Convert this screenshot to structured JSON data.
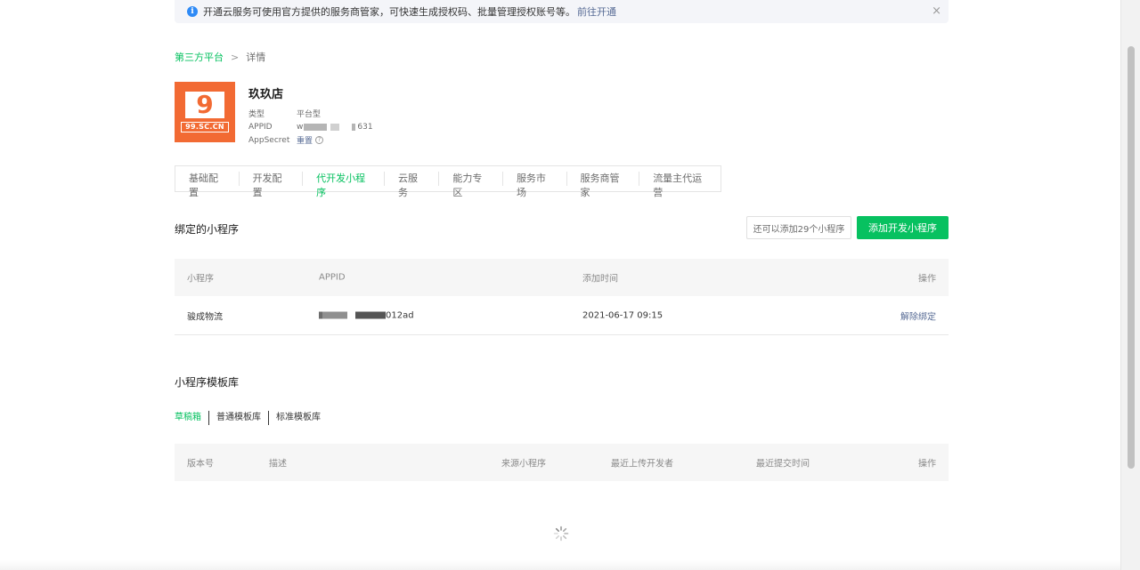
{
  "notice": {
    "icon": "info-icon",
    "text": "开通云服务可使用官方提供的服务商管家，可快速生成授权码、批量管理授权账号等。",
    "link": "前往开通",
    "close": "×"
  },
  "breadcrumb": {
    "parent": "第三方平台",
    "separator": ">",
    "current": "详情"
  },
  "logo": {
    "nine": "9",
    "text": "99.SC.CN",
    "color": "#f26a33"
  },
  "app": {
    "name": "玖玖店",
    "type_label": "类型",
    "type_value": "平台型",
    "appid_label": "APPID",
    "appid_prefix": "w",
    "appid_suffix": "631",
    "secret_label": "AppSecret",
    "secret_link": "重置",
    "help": "?"
  },
  "tabs": [
    {
      "label": "基础配置",
      "active": false
    },
    {
      "label": "开发配置",
      "active": false
    },
    {
      "label": "代开发小程序",
      "active": true
    },
    {
      "label": "云服务",
      "active": false
    },
    {
      "label": "能力专区",
      "active": false
    },
    {
      "label": "服务市场",
      "active": false
    },
    {
      "label": "服务商管家",
      "active": false
    },
    {
      "label": "流量主代运营",
      "active": false
    }
  ],
  "bound": {
    "title": "绑定的小程序",
    "quota_text": "还可以添加29个小程序",
    "add_button": "添加开发小程序",
    "columns": {
      "name": "小程序",
      "appid": "APPID",
      "time": "添加时间",
      "action": "操作"
    },
    "rows": [
      {
        "name": "骏成物流",
        "appid_suffix": "012ad",
        "time": "2021-06-17 09:15",
        "action": "解除绑定"
      }
    ]
  },
  "templates": {
    "title": "小程序模板库",
    "subtabs": [
      {
        "label": "草稿箱",
        "active": true
      },
      {
        "label": "普通模板库",
        "active": false
      },
      {
        "label": "标准模板库",
        "active": false
      }
    ],
    "columns": {
      "version": "版本号",
      "desc": "描述",
      "source": "来源小程序",
      "uploader": "最近上传开发者",
      "submit_time": "最近提交时间",
      "action": "操作"
    }
  },
  "colors": {
    "accent": "#07c160",
    "link": "#576b95",
    "info": "#2e8af6"
  }
}
